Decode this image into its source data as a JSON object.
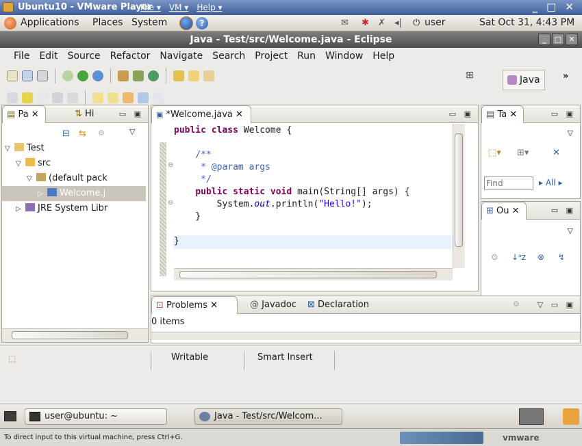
{
  "vmware": {
    "title": "Ubuntu10 - VMware Player",
    "menus": [
      "File ▾",
      "VM ▾",
      "Help ▾"
    ],
    "controls": "_ □ ✕"
  },
  "gnome_panel": {
    "menus": [
      "Applications",
      "Places",
      "System"
    ],
    "user": "user",
    "clock": "Sat Oct 31, 4:43 PM"
  },
  "eclipse": {
    "title": "Java - Test/src/Welcome.java - Eclipse",
    "menu": [
      "File",
      "Edit",
      "Source",
      "Refactor",
      "Navigate",
      "Search",
      "Project",
      "Run",
      "Window",
      "Help"
    ],
    "perspective": "Java",
    "more": "»"
  },
  "package_explorer": {
    "tabs": [
      "Pa ✕",
      "Hi"
    ],
    "tree": [
      {
        "label": "Test",
        "indent": 0,
        "twisty": "▽"
      },
      {
        "label": "src",
        "indent": 1,
        "twisty": "▽"
      },
      {
        "label": "(default pack",
        "indent": 2,
        "twisty": "▽"
      },
      {
        "label": "Welcome.j",
        "indent": 3,
        "twisty": "▷",
        "selected": true
      },
      {
        "label": "JRE System Libr",
        "indent": 0,
        "twisty": "▷"
      }
    ]
  },
  "editor": {
    "tab_label": "*Welcome.java ✕",
    "lines": [
      {
        "html": "<span class='kw'>public class</span> Welcome {"
      },
      {
        "html": ""
      },
      {
        "html": "    <span class='cm'>/**</span>"
      },
      {
        "html": "     <span class='cm'>* @param args</span>"
      },
      {
        "html": "     <span class='cm'>*/</span>"
      },
      {
        "html": "    <span class='kw'>public static void</span> main(String[] args) {"
      },
      {
        "html": "        System.<span class='ital'>out</span>.println(<span class='str'>\"Hello!\"</span>);"
      },
      {
        "html": "    }"
      },
      {
        "html": ""
      },
      {
        "html": "}"
      }
    ]
  },
  "tasks_view": {
    "tab": "Ta ✕",
    "find_placeholder": "Find",
    "all_label": "▸ All ▸"
  },
  "outline_view": {
    "tab": "Ou ✕"
  },
  "problems": {
    "tabs": [
      "Problems ✕",
      "Javadoc",
      "Declaration"
    ],
    "summary": "0 items"
  },
  "status": {
    "writable": "Writable",
    "insert_mode": "Smart Insert"
  },
  "taskbar": {
    "items": [
      "user@ubuntu: ~",
      "Java - Test/src/Welcom..."
    ]
  },
  "vm_status": {
    "hint": "To direct input to this virtual machine, press Ctrl+G.",
    "brand": "vmware"
  },
  "colors": {
    "keyword": "#7f0055",
    "comment": "#3f5fbf",
    "string": "#2a00ff",
    "selection": "#c9c5bd"
  }
}
